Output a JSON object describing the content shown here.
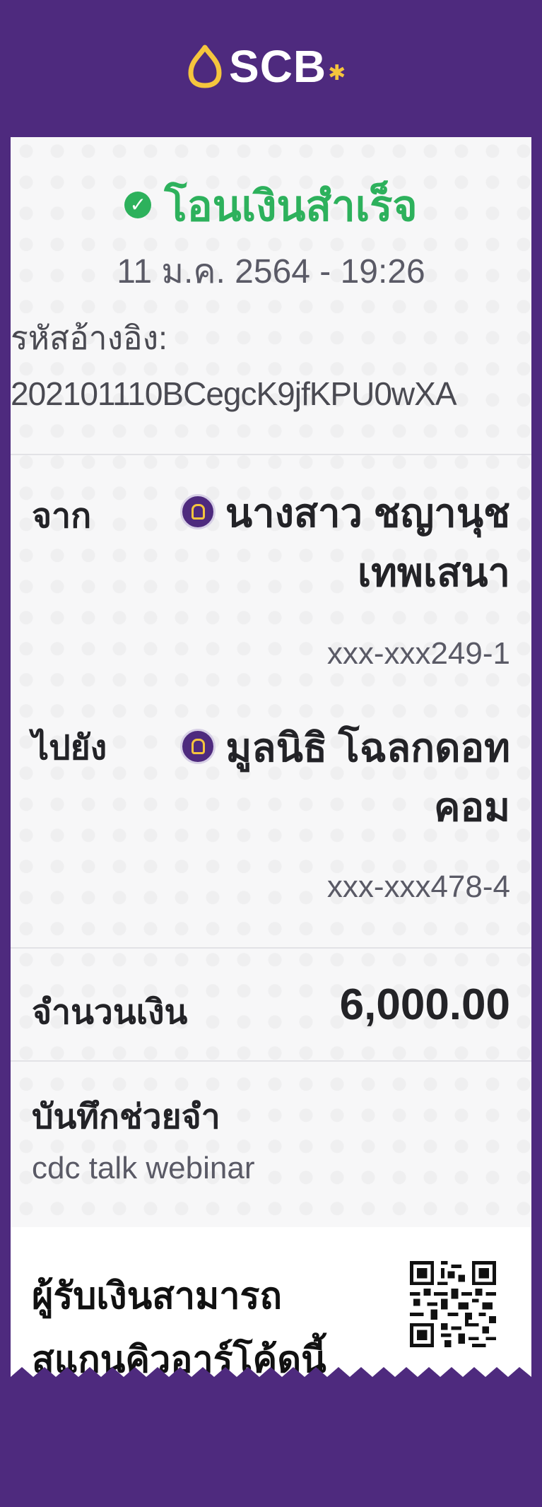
{
  "header": {
    "logo_text": "SCB",
    "logo_star": "✱",
    "logo_icon": "scb-siam-icon"
  },
  "receipt": {
    "status_check": "✓",
    "status": "โอนเงินสำเร็จ",
    "datetime": "11 ม.ค. 2564 - 19:26",
    "ref_label": "รหัสอ้างอิง:",
    "ref_value": "202101110BCegcK9jfKPU0wXA",
    "from": {
      "label": "จาก",
      "name_line1": "นางสาว ชญานุช",
      "name_line2": "เทพเสนา",
      "account": "xxx-xxx249-1"
    },
    "to": {
      "label": "ไปยัง",
      "name_line1": "มูลนิธิ โฉลกดอท",
      "name_line2": "คอม",
      "account": "xxx-xxx478-4"
    },
    "amount": {
      "label": "จำนวนเงิน",
      "value": "6,000.00"
    },
    "memo": {
      "label": "บันทึกช่วยจำ",
      "value": "cdc talk webinar"
    },
    "qr": {
      "text_line1": "ผู้รับเงินสามารถ",
      "text_line2": "สแกนคิวอาร์โค้ดนี้"
    }
  },
  "colors": {
    "brand_purple": "#4e2a7e",
    "success_green": "#2db15c",
    "gold": "#f5c53d"
  }
}
